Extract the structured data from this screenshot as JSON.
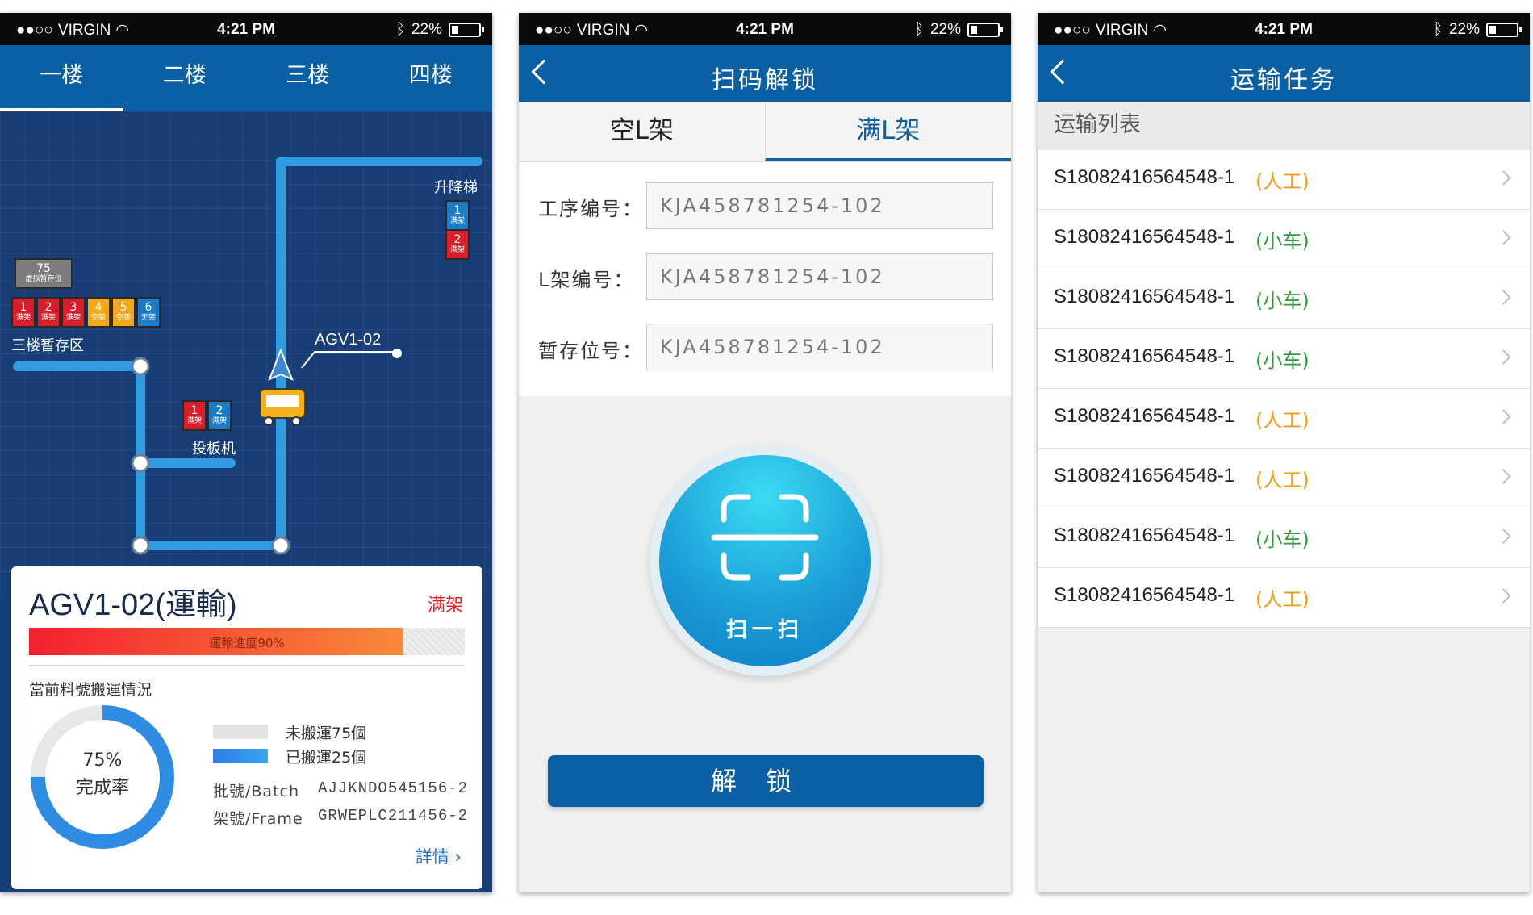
{
  "status_bar": {
    "carrier": "VIRGIN",
    "time": "4:21 PM",
    "battery": "22%"
  },
  "screen1": {
    "floor_tabs": [
      {
        "label": "一楼",
        "active": true
      },
      {
        "label": "二楼",
        "active": false
      },
      {
        "label": "三楼",
        "active": false
      },
      {
        "label": "四楼",
        "active": false
      }
    ],
    "map": {
      "elevator_label": "升降梯",
      "elevator_boxes": [
        {
          "num": "1",
          "state": "满架",
          "color": "#1c7cc8"
        },
        {
          "num": "2",
          "state": "满架",
          "color": "#d81e2a"
        }
      ],
      "virtual_box": {
        "num": "75",
        "state": "虚拟暂存位"
      },
      "staging_label": "三楼暂存区",
      "staging_boxes": [
        {
          "num": "1",
          "state": "满架",
          "color": "#d81e2a"
        },
        {
          "num": "2",
          "state": "满架",
          "color": "#d81e2a"
        },
        {
          "num": "3",
          "state": "满架",
          "color": "#d81e2a"
        },
        {
          "num": "4",
          "state": "空架",
          "color": "#f3a818"
        },
        {
          "num": "5",
          "state": "空架",
          "color": "#f3a818"
        },
        {
          "num": "6",
          "state": "无架",
          "color": "#1c7cc8"
        }
      ],
      "loader_label": "投板机",
      "loader_boxes": [
        {
          "num": "1",
          "state": "满架",
          "color": "#d81e2a"
        },
        {
          "num": "2",
          "state": "满架",
          "color": "#1c7cc8"
        }
      ],
      "agv_label": "AGV1-02"
    },
    "card": {
      "title": "AGV1-02(運輸)",
      "status": "满架",
      "progress_label": "運輸進度90%",
      "progress_pct": 0.86,
      "section_title": "當前料號搬運情況",
      "donut_pct_text": "75%",
      "donut_sub_text": "完成率",
      "donut_pct": 0.75,
      "legend_pending": "未搬運75個",
      "legend_done": "已搬運25個",
      "batch_key": "批號/Batch",
      "batch_val": "AJJKNDO545156-2",
      "frame_key": "架號/Frame",
      "frame_val": "GRWEPLC211456-2",
      "details": "詳情"
    }
  },
  "screen2": {
    "title": "扫码解锁",
    "tabs": [
      {
        "label": "空L架"
      },
      {
        "label": "满L架"
      }
    ],
    "fields": [
      {
        "label": "工序编号：",
        "value": "KJA458781254-102"
      },
      {
        "label": "L架编号：",
        "value": "KJA458781254-102"
      },
      {
        "label": "暂存位号：",
        "value": "KJA458781254-102"
      }
    ],
    "scan_label": "扫一扫",
    "unlock_label": "解锁"
  },
  "screen3": {
    "title": "运输任务",
    "list_header": "运输列表",
    "items": [
      {
        "id": "S18082416564548-1",
        "type": "(人工)",
        "kind": "manual"
      },
      {
        "id": "S18082416564548-1",
        "type": "(小车)",
        "kind": "cart"
      },
      {
        "id": "S18082416564548-1",
        "type": "(小车)",
        "kind": "cart"
      },
      {
        "id": "S18082416564548-1",
        "type": "(小车)",
        "kind": "cart"
      },
      {
        "id": "S18082416564548-1",
        "type": "(人工)",
        "kind": "manual"
      },
      {
        "id": "S18082416564548-1",
        "type": "(人工)",
        "kind": "manual"
      },
      {
        "id": "S18082416564548-1",
        "type": "(小车)",
        "kind": "cart"
      },
      {
        "id": "S18082416564548-1",
        "type": "(人工)",
        "kind": "manual"
      }
    ]
  }
}
